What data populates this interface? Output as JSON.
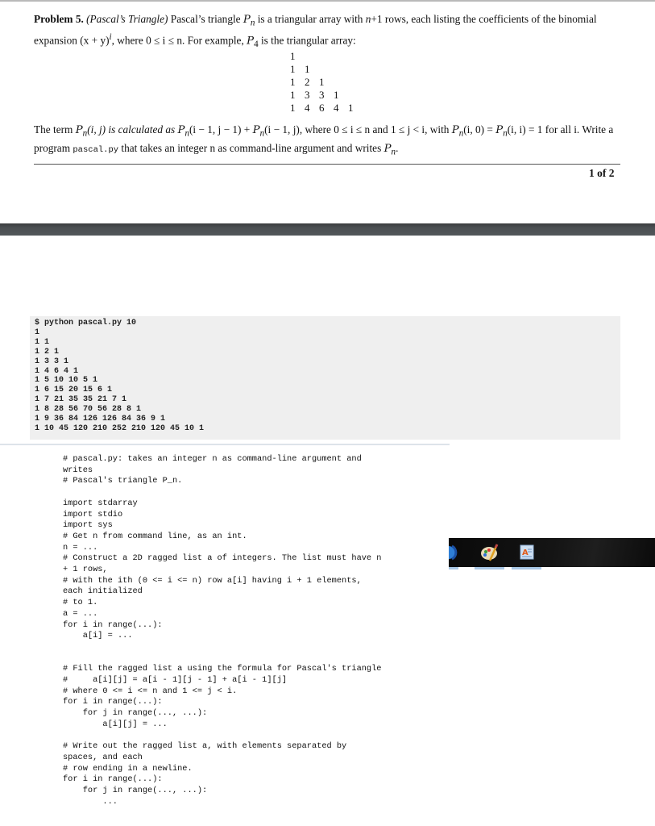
{
  "page1": {
    "problem_label": "Problem 5.",
    "problem_topic": "(Pascal’s Triangle)",
    "intro_text_1": "Pascal’s triangle",
    "symbol_P": "P",
    "sub_n": "n",
    "intro_text_2": "is a triangular array with",
    "intro_math_1": "n",
    "intro_text_3": "+1 rows, each listing the coefficients of the",
    "intro_text_4": "binomial expansion (x + y)",
    "sup_i": "i",
    "intro_text_5": ", where 0 ≤ i ≤ n. For example,",
    "sub_4": "4",
    "intro_text_6": "is the triangular array:",
    "example_triangle": [
      [
        "1"
      ],
      [
        "1",
        "1"
      ],
      [
        "1",
        "2",
        "1"
      ],
      [
        "1",
        "3",
        "3",
        "1"
      ],
      [
        "1",
        "4",
        "6",
        "4",
        "1"
      ]
    ],
    "para2_a": "The term",
    "para2_b": "(i, j) is calculated as",
    "para2_c": "(i − 1, j − 1) +",
    "para2_d": "(i − 1, j), where 0 ≤ i ≤ n and 1 ≤ j < i, with",
    "para2_e": "(i, 0) =",
    "para2_f": "(i, i) = 1",
    "para2_g": "for all i. Write a program",
    "program_name": "pascal.py",
    "para2_h": "that takes an integer n as command-line argument and writes",
    "para2_end": ".",
    "page_number": "1 of 2"
  },
  "terminal": {
    "command": "$ python pascal.py 10",
    "output_lines": [
      "1",
      "1 1",
      "1 2 1",
      "1 3 3 1",
      "1 4 6 4 1",
      "1 5 10 10 5 1",
      "1 6 15 20 15 6 1",
      "1 7 21 35 35 21 7 1",
      "1 8 28 56 70 56 28 8 1",
      "1 9 36 84 126 126 84 36 9 1",
      "1 10 45 120 210 252 210 120 45 10 1"
    ]
  },
  "code": {
    "lines": [
      "# pascal.py: takes an integer n as command-line argument and",
      "writes",
      "# Pascal's triangle P_n.",
      "",
      "import stdarray",
      "import stdio",
      "import sys",
      "# Get n from command line, as an int.",
      "n = ...",
      "# Construct a 2D ragged list a of integers. The list must have n",
      "+ 1 rows,",
      "# with the ith (0 <= i <= n) row a[i] having i + 1 elements,",
      "each initialized",
      "# to 1.",
      "a = ...",
      "for i in range(...):",
      "    a[i] = ...",
      "",
      "",
      "# Fill the ragged list a using the formula for Pascal's triangle",
      "#     a[i][j] = a[i - 1][j - 1] + a[i - 1][j]",
      "# where 0 <= i <= n and 1 <= j < i.",
      "for i in range(...):",
      "    for j in range(..., ...):",
      "        a[i][j] = ...",
      "",
      "# Write out the ragged list a, with elements separated by",
      "spaces, and each",
      "# row ending in a newline.",
      "for i in range(...):",
      "    for j in range(..., ...):",
      "        ..."
    ]
  },
  "taskbar": {
    "items": [
      {
        "icon": "media-player-icon"
      },
      {
        "icon": "paint-icon"
      },
      {
        "icon": "wordpad-icon"
      }
    ]
  }
}
